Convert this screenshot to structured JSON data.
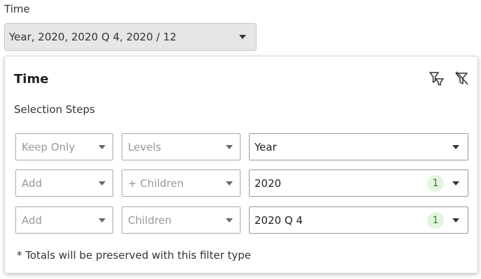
{
  "filter": {
    "label": "Time",
    "selected_value": "Year, 2020, 2020 Q 4, 2020 / 12"
  },
  "panel": {
    "title": "Time",
    "icons": [
      "filter-icon",
      "clear-filter-icon"
    ],
    "steps_label": "Selection Steps",
    "rows": [
      {
        "action": "Keep Only",
        "relation": "Levels",
        "member": "Year",
        "count": ""
      },
      {
        "action": "Add",
        "relation": "+ Children",
        "member": "2020",
        "count": "1"
      },
      {
        "action": "Add",
        "relation": "Children",
        "member": "2020 Q 4",
        "count": "1"
      }
    ],
    "note": "* Totals will be preserved with this filter type"
  },
  "colors": {
    "badge_bg": "#e4f5e0",
    "badge_text": "#3b7d36",
    "selector_bg": "#e6e6e6"
  }
}
